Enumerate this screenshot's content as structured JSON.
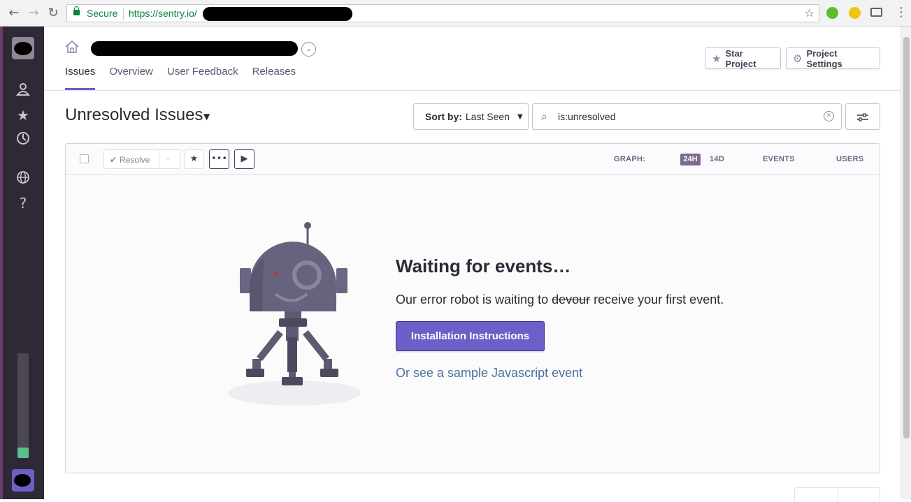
{
  "browser": {
    "secure_label": "Secure",
    "url_prefix": "https://sentry.io/",
    "nav": {
      "back": "←",
      "forward": "→",
      "reload": "↻"
    }
  },
  "sidebar": {
    "icons": [
      "user-icon",
      "star-icon",
      "activity-icon",
      "globe-icon",
      "help-icon"
    ],
    "help_glyph": "?",
    "progress_fraction": 0.1
  },
  "header": {
    "tabs": [
      "Issues",
      "Overview",
      "User Feedback",
      "Releases"
    ],
    "star_project": "Star Project",
    "project_settings": "Project Settings"
  },
  "issues": {
    "title": "Unresolved Issues",
    "sort_label": "Sort by:",
    "sort_value": "Last Seen",
    "search_value": "is:unresolved"
  },
  "toolbar": {
    "resolve": "Resolve",
    "graph_label": "GRAPH:",
    "range_24h": "24H",
    "range_14d": "14D",
    "events": "EVENTS",
    "users": "USERS"
  },
  "empty_state": {
    "title": "Waiting for events…",
    "text_before": "Our error robot is waiting to ",
    "text_struck": "devour",
    "text_after": " receive your first event.",
    "install_button": "Installation Instructions",
    "sample_link": "Or see a sample Javascript event"
  },
  "colors": {
    "accent": "#6c5fc7",
    "sidebar_bg": "#2f2936",
    "secure_green": "#0b8043",
    "link": "#4c6fa0"
  }
}
